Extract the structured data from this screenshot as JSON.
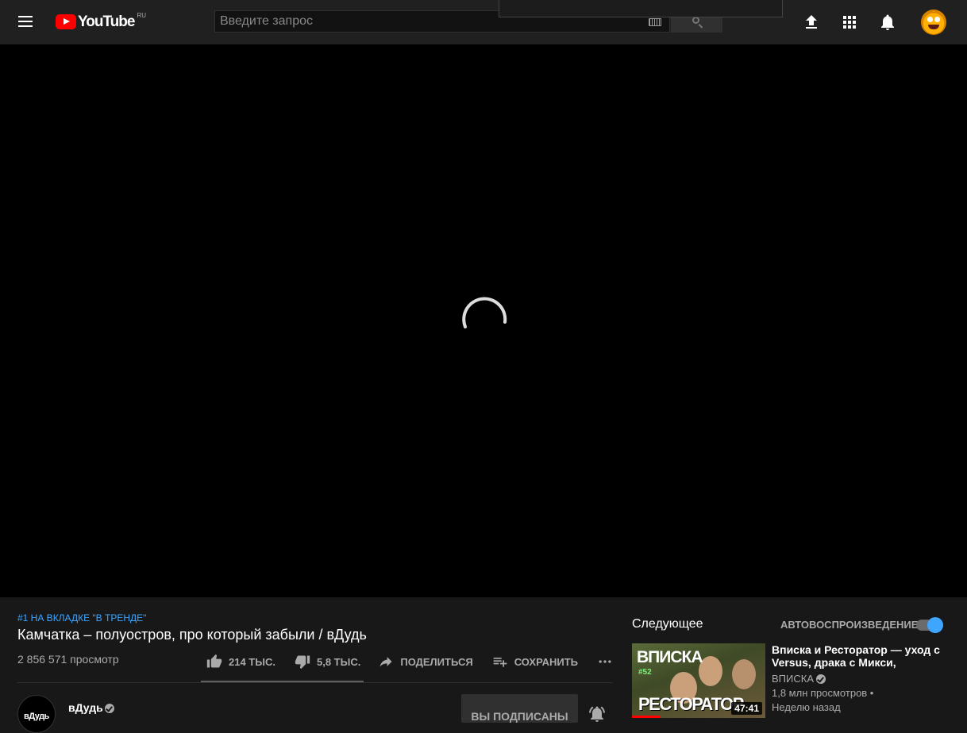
{
  "header": {
    "logo_text": "YouTube",
    "region": "RU",
    "search_placeholder": "Введите запрос"
  },
  "video": {
    "trending_tag": "#1 НА ВКЛАДКЕ \"В ТРЕНДЕ\"",
    "title": "Камчатка – полуостров, про который забыли / вДудь",
    "views": "2 856 571 просмотр",
    "likes": "214 ТЫС.",
    "dislikes": "5,8 ТЫС.",
    "share_label": "ПОДЕЛИТЬСЯ",
    "save_label": "СОХРАНИТЬ"
  },
  "channel": {
    "name": "вДудь",
    "avatar_text": "вДудь",
    "subscribe_label": "ВЫ ПОДПИСАНЫ"
  },
  "sidebar": {
    "up_next_label": "Следующее",
    "autoplay_label": "АВТОВОСПРОИЗВЕДЕНИЕ",
    "autoplay_on": true,
    "next_video": {
      "title": "Вписка и Ресторатор — уход с Versus, драка с Микси, долги…",
      "channel": "ВПИСКА",
      "views": "1,8 млн просмотров •",
      "age": "Неделю назад",
      "duration": "47:41",
      "thumb_brand": "ВПИСКА",
      "thumb_episode": "#52",
      "thumb_caption": "РЕСТОРАТОР"
    }
  },
  "colors": {
    "accent_blue": "#3ea6ff",
    "brand_red": "#ff0000",
    "background": "#181818",
    "player": "#000000"
  }
}
